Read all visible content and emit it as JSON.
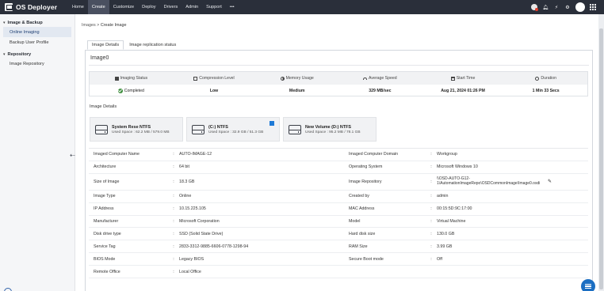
{
  "app": {
    "title": "OS Deployer"
  },
  "nav": [
    "Home",
    "Create",
    "Customize",
    "Deploy",
    "Drivers",
    "Admin",
    "Support"
  ],
  "nav_more": "•••",
  "nav_active": "Create",
  "sidebar": {
    "sections": [
      {
        "title": "Image & Backup",
        "items": [
          "Online Imaging",
          "Backup User Profile"
        ]
      },
      {
        "title": "Repository",
        "items": [
          "Image Repository"
        ]
      }
    ],
    "active_item": "Online Imaging"
  },
  "breadcrumb": {
    "parent": "Images",
    "separator": " > ",
    "current": "Create Image"
  },
  "tabs": [
    "Image Details",
    "Image replication status"
  ],
  "panel": {
    "title": "Image0"
  },
  "stats": {
    "headers": [
      "Imaging Status",
      "Compression Level",
      "Memory Usage",
      "Average Speed",
      "Start Time",
      "Duration"
    ],
    "values": [
      "Completed",
      "Low",
      "Medium",
      "329 MB/sec",
      "Aug 21, 2024 01:26 PM",
      "1 Min 33 Secs"
    ]
  },
  "image_details_label": "Image Details",
  "disks": [
    {
      "name": "System Rese NTFS",
      "usage": "Used Space : 62.2 MB / 579.0 MB"
    },
    {
      "name": "(C:) NTFS",
      "usage": "Used Space : 32.9 GB / 51.3 GB"
    },
    {
      "name": "New Volume (D:) NTFS",
      "usage": "Used Space : 95.2 MB / 78.1 GB"
    }
  ],
  "details": [
    {
      "l1": "Imaged Computer Name",
      "v1": "AUTO-IMAGE-12",
      "l2": "Imaged Computer Domain",
      "v2": "Workgroup"
    },
    {
      "l1": "Architecture",
      "v1": "64 bit",
      "l2": "Operating System",
      "v2": "Microsoft Windows 10"
    },
    {
      "l1": "Size of Image",
      "v1": "18.3 GB",
      "l2": "Image Repository",
      "v2": "\\\\OSD-AUTO-G12-1\\AutomationImageRepo\\OSDCommonImage\\Image0.osdi"
    },
    {
      "l1": "Image Type",
      "v1": "Online",
      "l2": "Created by",
      "v2": "admin"
    },
    {
      "l1": "IP Address",
      "v1": "10.15.225.105",
      "l2": "MAC Address",
      "v2": "00:15:5D:9C:17:00"
    },
    {
      "l1": "Manufacturer",
      "v1": "Microsoft Corporation",
      "l2": "Model",
      "v2": "Virtual Machine"
    },
    {
      "l1": "Disk drive type",
      "v1": "SSD (Solid State Drive)",
      "l2": "Hard disk size",
      "v2": "130.0 GB"
    },
    {
      "l1": "Service Tag",
      "v1": "2833-3312-9885-6606-0778-1298-94",
      "l2": "RAM Size",
      "v2": "3.99 GB"
    },
    {
      "l1": "BIOS Mode",
      "v1": "Legacy BIOS",
      "l2": "Secure Boot mode",
      "v2": "Off"
    },
    {
      "l1": "Remote Office",
      "v1": "Local Office",
      "l2": "",
      "v2": ""
    }
  ],
  "separator": ":",
  "icons": {
    "top_right": [
      "license-icon",
      "notification-icon",
      "power-icon",
      "settings-icon",
      "avatar",
      "app-grid-icon"
    ],
    "accent": "#1b6ec2",
    "topbar_bg": "#2a2f3a",
    "status_ok": "#3e8e3e"
  }
}
